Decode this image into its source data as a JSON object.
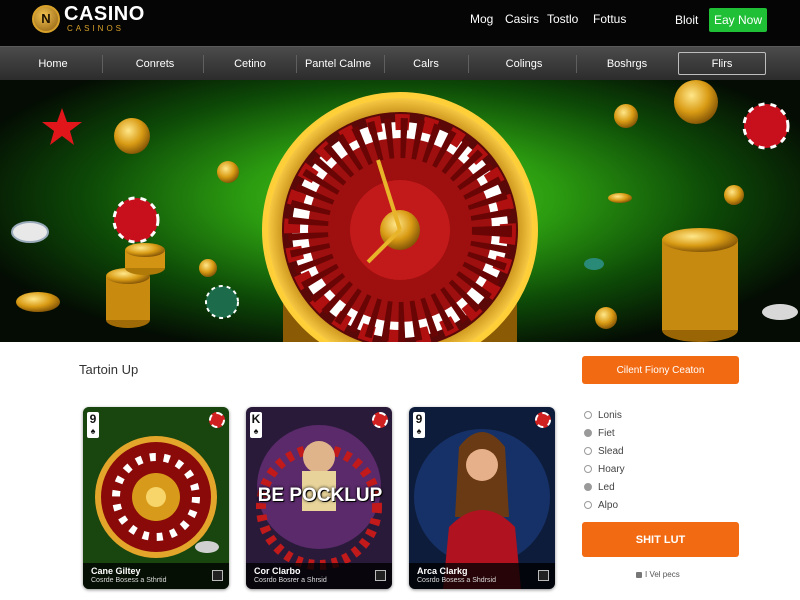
{
  "header": {
    "logo_badge": "N",
    "logo_main": "CASINO",
    "logo_sub": "CASINOS",
    "links": [
      "Mog",
      "Casirs",
      "Tostlo",
      "Fottus"
    ],
    "signin": "Bloit",
    "cta": "Eay Now"
  },
  "nav": {
    "items": [
      "Home",
      "Conrets",
      "Cetino",
      "Pantel Calme",
      "Calrs",
      "Colings",
      "Boshrgs"
    ],
    "boxed": "Flirs"
  },
  "main": {
    "section_title": "Tartoin Up",
    "cards": [
      {
        "rank": "9",
        "suit": "♠",
        "title": "Cane Giltey",
        "sub": "Cosrde Bosess a Sthrtid",
        "art_text": "",
        "chip_color": "#d12020"
      },
      {
        "rank": "K",
        "suit": "♠",
        "title": "Cor Clarbo",
        "sub": "Cosrdo Bosrer a Shrsid",
        "art_text": "BE POCKLUP",
        "chip_color": "#d12020"
      },
      {
        "rank": "9",
        "suit": "♠",
        "title": "Arca Clarkg",
        "sub": "Cosrdo Bosess a Shdrsid",
        "art_text": "",
        "chip_color": "#d12020"
      }
    ]
  },
  "sidebar": {
    "filter_button": "Cilent Fiony Ceaton",
    "options": [
      {
        "label": "Lonis",
        "filled": false
      },
      {
        "label": "Fiet",
        "filled": true
      },
      {
        "label": "Slead",
        "filled": false
      },
      {
        "label": "Hoary",
        "filled": false
      },
      {
        "label": "Led",
        "filled": true
      },
      {
        "label": "Alpo",
        "filled": false
      }
    ],
    "submit": "SHIT LUT",
    "note": "I Vel pecs"
  },
  "colors": {
    "accent_orange": "#f26a12",
    "cta_green": "#1fbf36",
    "gold": "#d8a12a",
    "hero_green": "#3fbd17"
  }
}
